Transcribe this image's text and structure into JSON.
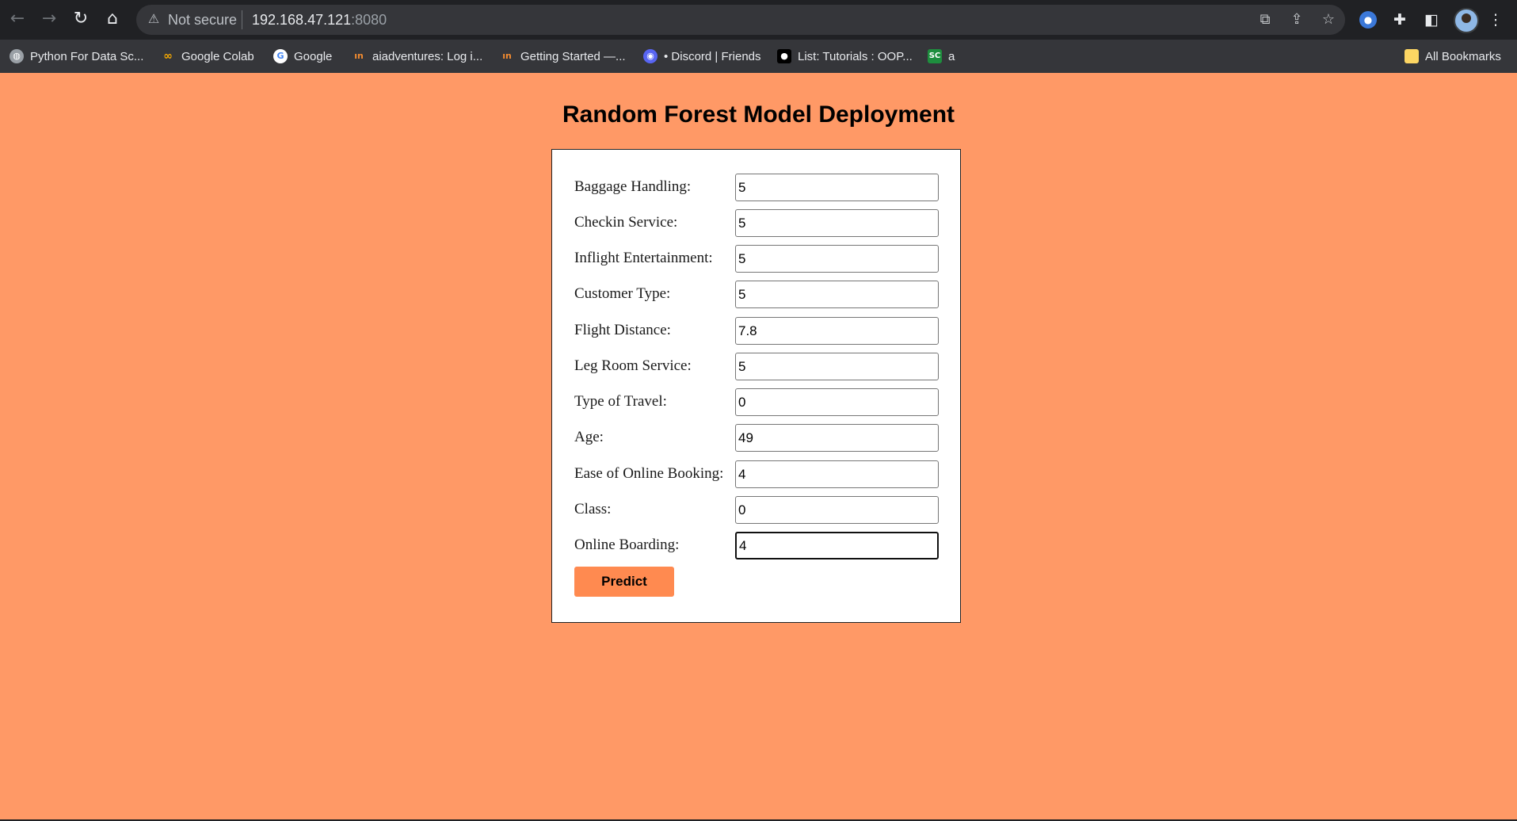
{
  "browser": {
    "security_label": "Not secure",
    "url_host": "192.168.47.121",
    "url_port": ":8080",
    "bookmarks": [
      {
        "label": "Python For Data Sc...",
        "icon": "globe-icon"
      },
      {
        "label": "Google Colab",
        "icon": "colab-icon"
      },
      {
        "label": "Google",
        "icon": "google-icon"
      },
      {
        "label": "aiadventures: Log i...",
        "icon": "aiadventures-icon"
      },
      {
        "label": "Getting Started —...",
        "icon": "aiadventures-icon"
      },
      {
        "label": "• Discord | Friends",
        "icon": "discord-icon"
      },
      {
        "label": "List: Tutorials : OOP...",
        "icon": "medium-icon"
      },
      {
        "label": "a",
        "icon": "sc-icon"
      }
    ],
    "all_bookmarks_label": "All Bookmarks"
  },
  "page": {
    "title": "Random Forest Model Deployment",
    "background_color": "#ff9966",
    "button_color": "#ff8a50",
    "fields": [
      {
        "label": "Baggage Handling:",
        "value": "5"
      },
      {
        "label": "Checkin Service:",
        "value": "5"
      },
      {
        "label": "Inflight Entertainment:",
        "value": "5"
      },
      {
        "label": "Customer Type:",
        "value": "5"
      },
      {
        "label": "Flight Distance:",
        "value": "7.8"
      },
      {
        "label": "Leg Room Service:",
        "value": "5"
      },
      {
        "label": "Type of Travel:",
        "value": "0"
      },
      {
        "label": "Age:",
        "value": "49"
      },
      {
        "label": "Ease of Online Booking:",
        "value": "4"
      },
      {
        "label": "Class:",
        "value": "0"
      },
      {
        "label": "Online Boarding:",
        "value": "4"
      }
    ],
    "predict_label": "Predict"
  }
}
